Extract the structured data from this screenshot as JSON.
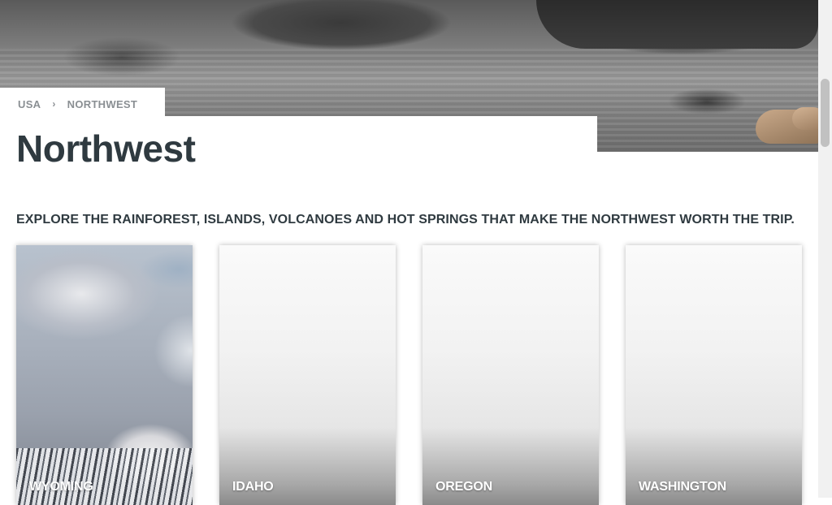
{
  "breadcrumb": {
    "items": [
      "USA",
      "NORTHWEST"
    ],
    "separator": "›"
  },
  "page": {
    "title": "Northwest",
    "tagline": "EXPLORE THE RAINFOREST, ISLANDS, VOLCANOES AND HOT SPRINGS THAT MAKE THE NORTHWEST WORTH THE TRIP."
  },
  "cards": [
    {
      "label": "WYOMING"
    },
    {
      "label": "IDAHO"
    },
    {
      "label": "OREGON"
    },
    {
      "label": "WASHINGTON"
    }
  ],
  "colors": {
    "text": "#2f3a40",
    "breadcrumb": "#8a8f93",
    "card_label": "#ffffff"
  }
}
